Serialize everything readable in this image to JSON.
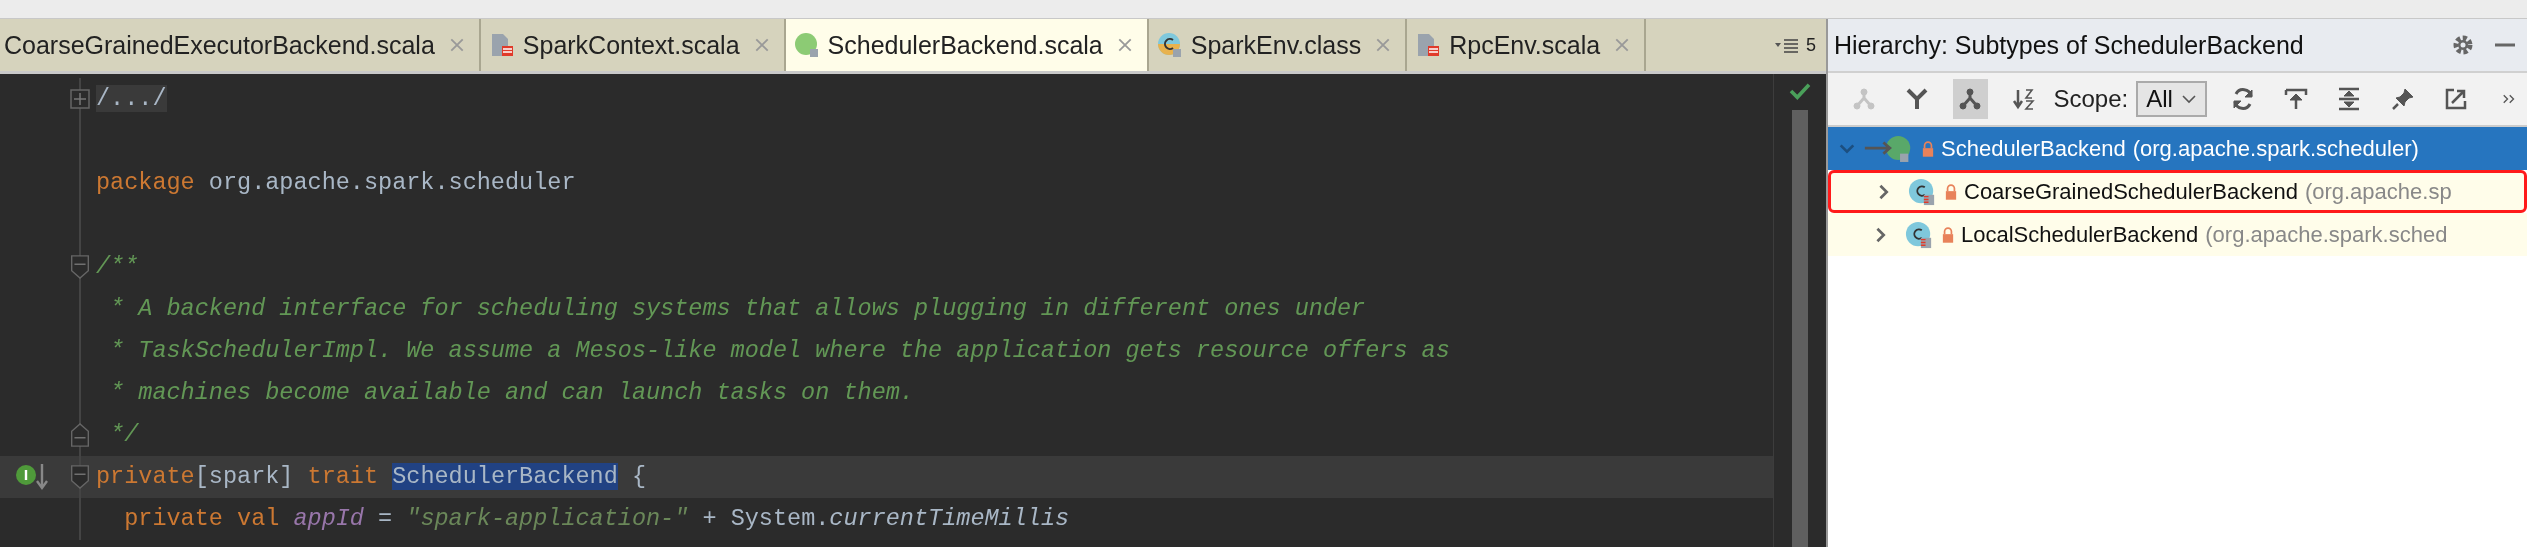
{
  "tabs": [
    {
      "label": "CoarseGrainedExecutorBackend.scala",
      "kind": "cut",
      "selected": false
    },
    {
      "label": "SparkContext.scala",
      "kind": "scala",
      "selected": false
    },
    {
      "label": "SchedulerBackend.scala",
      "kind": "trait",
      "selected": true
    },
    {
      "label": "SparkEnv.class",
      "kind": "class",
      "selected": false
    },
    {
      "label": "RpcEnv.scala",
      "kind": "scala",
      "selected": false
    }
  ],
  "tab_overflow": "5",
  "editor": {
    "lines": [
      {
        "kind": "folded",
        "implemented": false,
        "current": false,
        "tokens": [
          {
            "kind": "folded",
            "text": "/.../"
          }
        ]
      },
      {
        "kind": "code",
        "implemented": false,
        "current": false
      },
      {
        "kind": "code",
        "implemented": false,
        "current": false,
        "tokens": [
          {
            "kind": "keyword",
            "text": "package"
          },
          {
            "kind": "plain",
            "text": " org.apache.spark.scheduler"
          }
        ]
      },
      {
        "kind": "code",
        "implemented": false,
        "current": false
      },
      {
        "kind": "open",
        "implemented": false,
        "current": false,
        "tokens": [
          {
            "kind": "comment",
            "text": "/**"
          }
        ]
      },
      {
        "kind": "code",
        "implemented": false,
        "current": false,
        "tokens": [
          {
            "kind": "comment",
            "text": " * A backend interface for scheduling systems that allows plugging in different ones under"
          }
        ]
      },
      {
        "kind": "code",
        "implemented": false,
        "current": false,
        "tokens": [
          {
            "kind": "comment",
            "text": " * TaskSchedulerImpl. We assume a Mesos-like model where the application gets resource offers as"
          }
        ]
      },
      {
        "kind": "code",
        "implemented": false,
        "current": false,
        "tokens": [
          {
            "kind": "comment",
            "text": " * machines become available and can launch tasks on them."
          }
        ]
      },
      {
        "kind": "close",
        "implemented": false,
        "current": false,
        "tokens": [
          {
            "kind": "comment",
            "text": " */"
          }
        ]
      },
      {
        "kind": "open",
        "implemented": true,
        "current": true,
        "tokens": [
          {
            "kind": "keyword",
            "text": "private"
          },
          {
            "kind": "plain",
            "text": "[spark] "
          },
          {
            "kind": "keyword",
            "text": "trait "
          },
          {
            "kind": "selected",
            "text": "SchedulerBackend"
          },
          {
            "kind": "plain",
            "text": " {"
          }
        ]
      },
      {
        "kind": "code",
        "implemented": false,
        "current": false,
        "tokens": [
          {
            "kind": "keyword",
            "text": "  private val"
          },
          {
            "kind": "field",
            "text": " appId"
          },
          {
            "kind": "plain",
            "text": " = "
          },
          {
            "kind": "string",
            "text": "\"spark-application-\""
          },
          {
            "kind": "plain",
            "text": " + System."
          },
          {
            "kind": "method",
            "text": "currentTimeMillis"
          }
        ]
      }
    ]
  },
  "hierarchy": {
    "title": "Hierarchy:  Subtypes of SchedulerBackend",
    "toolbar": [
      {
        "kind": "supertypes",
        "selected": false,
        "disabled": true
      },
      {
        "kind": "merge",
        "selected": false,
        "disabled": false
      },
      {
        "kind": "subtypes",
        "selected": true,
        "disabled": false
      },
      {
        "kind": "sort",
        "selected": false,
        "disabled": false
      }
    ],
    "scope_label": "Scope:",
    "scope_value": "All",
    "actions": [
      {
        "kind": "refresh"
      },
      {
        "kind": "export"
      },
      {
        "kind": "expand"
      },
      {
        "kind": "pin"
      },
      {
        "kind": "open"
      },
      {
        "kind": "more"
      }
    ],
    "tree": [
      {
        "name": "SchedulerBackend",
        "package": "(org.apache.spark.scheduler)",
        "kind": "trait",
        "expanded": true,
        "selected": true,
        "highlighted": false,
        "children": [
          {
            "name": "CoarseGrainedSchedulerBackend",
            "package": "(org.apache.sp",
            "kind": "class",
            "expanded": false,
            "selected": false,
            "highlighted": true
          },
          {
            "name": "LocalSchedulerBackend",
            "package": "(org.apache.spark.sched",
            "kind": "class",
            "expanded": false,
            "selected": false,
            "highlighted": false
          }
        ]
      }
    ]
  }
}
